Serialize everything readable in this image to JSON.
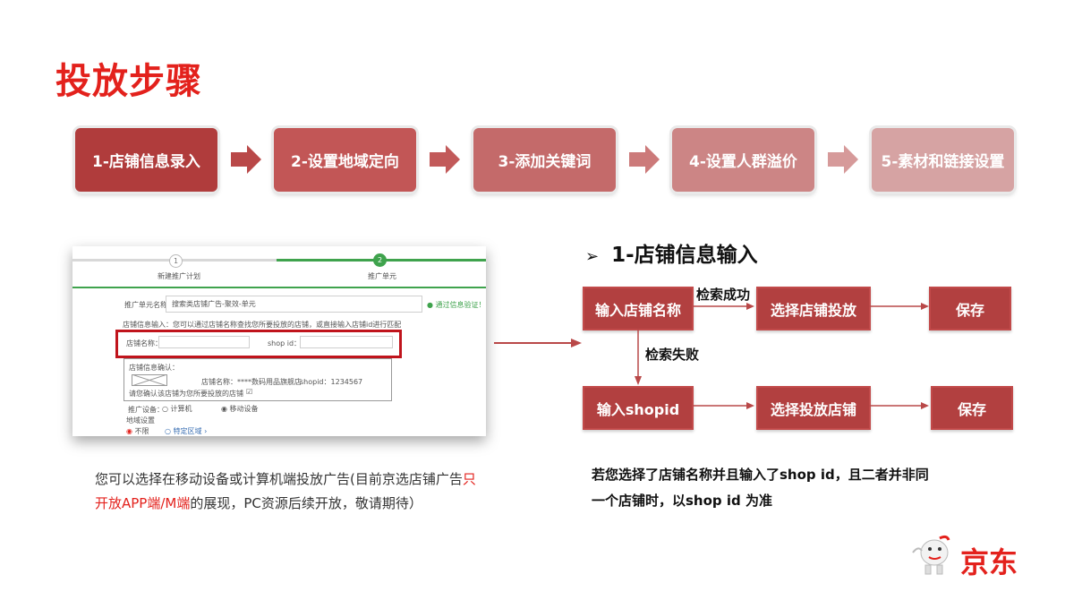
{
  "title": "投放步骤",
  "steps": [
    {
      "label": "1-店铺信息录入",
      "color": "#b03c3c"
    },
    {
      "label": "2-设置地域定向",
      "color": "#c25656"
    },
    {
      "label": "3-添加关键词",
      "color": "#c46a6a"
    },
    {
      "label": "4-设置人群溢价",
      "color": "#cc8585"
    },
    {
      "label": "5-素材和链接设置",
      "color": "#d6a3a3"
    }
  ],
  "screenshot": {
    "step1_num": "1",
    "step1_label": "新建推广计划",
    "step2_num": "2",
    "step2_label": "推广单元",
    "unit_name_label": "推广单元名称：",
    "unit_name_value": "搜索类店铺广告-聚效-单元",
    "verify_text": "通过信息验证！",
    "info_hint": "店铺信息输入：您可以通过店铺名称查找您所要投放的店铺，或直接输入店铺id进行匹配",
    "store_name_label": "店铺名称：",
    "shop_id_label": "shop id：",
    "confirm_title": "店铺信息确认：",
    "store_name_result": "店铺名称：****数码用品旗舰店",
    "shop_id_result": "shopid：1234567",
    "confirm_check_text": "请您确认该店铺为您所要投放的店铺",
    "device_label": "推广设备：",
    "device_pc": "计算机",
    "device_mobile": "移动设备",
    "region_label": "地域设置",
    "region_none": "不限",
    "region_specific": "特定区域 ›"
  },
  "flow": {
    "heading": "1-店铺信息输入",
    "box_store_name": "输入店铺名称",
    "label_success": "检索成功",
    "box_select_store": "选择店铺投放",
    "box_save_1": "保存",
    "label_fail": "检索失败",
    "box_shopid": "输入shopid",
    "box_select_store_2": "选择投放店铺",
    "box_save_2": "保存"
  },
  "note_left": {
    "part1": "您可以选择在移动设备或计算机端投放广告(目前京选店铺广告",
    "highlight": "只开放APP端/M端",
    "part2": "的展现，PC资源后续开放，敬请期待）"
  },
  "note_right": {
    "line1": "若您选择了店铺名称并且输入了shop  id，且二者并非同",
    "line2": "一个店铺时，以shop id 为准"
  },
  "logo": {
    "text": "京东",
    "color": "#e3211c"
  }
}
